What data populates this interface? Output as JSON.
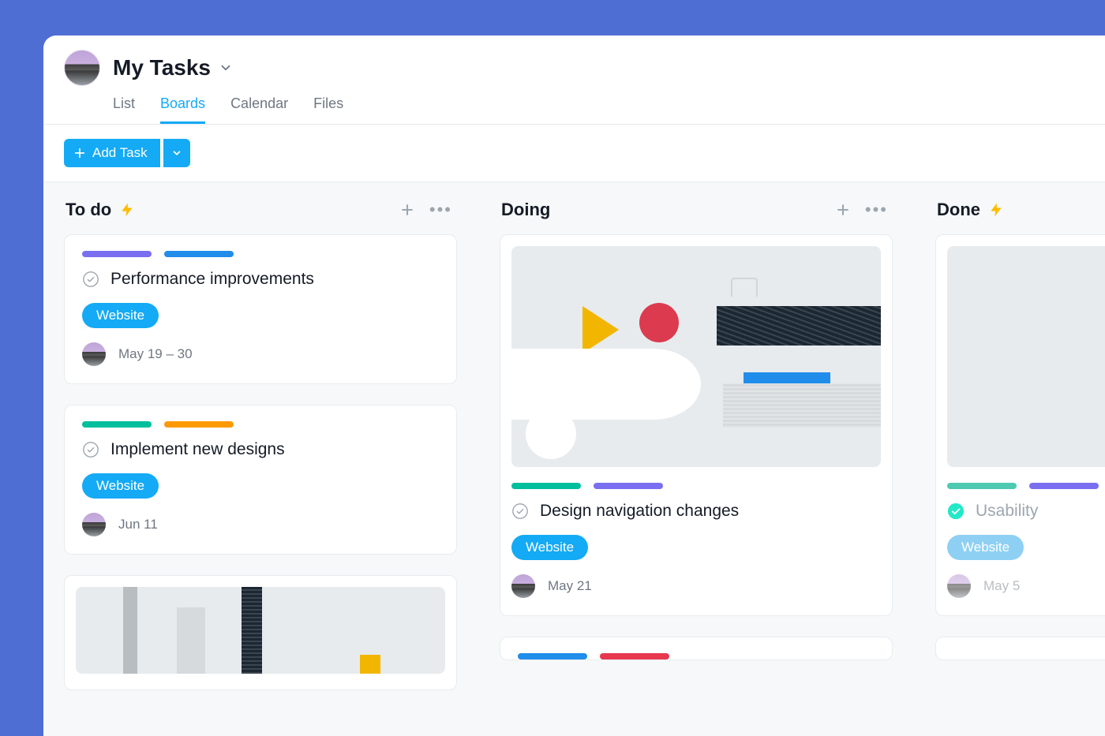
{
  "header": {
    "title": "My Tasks",
    "tabs": [
      "List",
      "Boards",
      "Calendar",
      "Files"
    ],
    "active_tab": "Boards"
  },
  "toolbar": {
    "add_task_label": "Add Task"
  },
  "columns": [
    {
      "title": "To do",
      "has_bolt": true,
      "cards": [
        {
          "pills": [
            "purple",
            "blue"
          ],
          "title": "Performance improvements",
          "tag": "Website",
          "date": "May 19 – 30",
          "completed": false
        },
        {
          "pills": [
            "green",
            "orange"
          ],
          "title": "Implement new designs",
          "tag": "Website",
          "date": "Jun 11",
          "completed": false
        }
      ]
    },
    {
      "title": "Doing",
      "has_bolt": false,
      "cards": [
        {
          "has_cover": true,
          "pills": [
            "green",
            "purple"
          ],
          "title": "Design navigation changes",
          "tag": "Website",
          "date": "May 21",
          "completed": false
        }
      ]
    },
    {
      "title": "Done",
      "has_bolt": true,
      "cards": [
        {
          "has_cover_partial": true,
          "pills": [
            "teal",
            "purple"
          ],
          "title": "Usability",
          "tag": "Website",
          "tag_light": true,
          "date": "May 5",
          "completed": true
        }
      ]
    }
  ]
}
